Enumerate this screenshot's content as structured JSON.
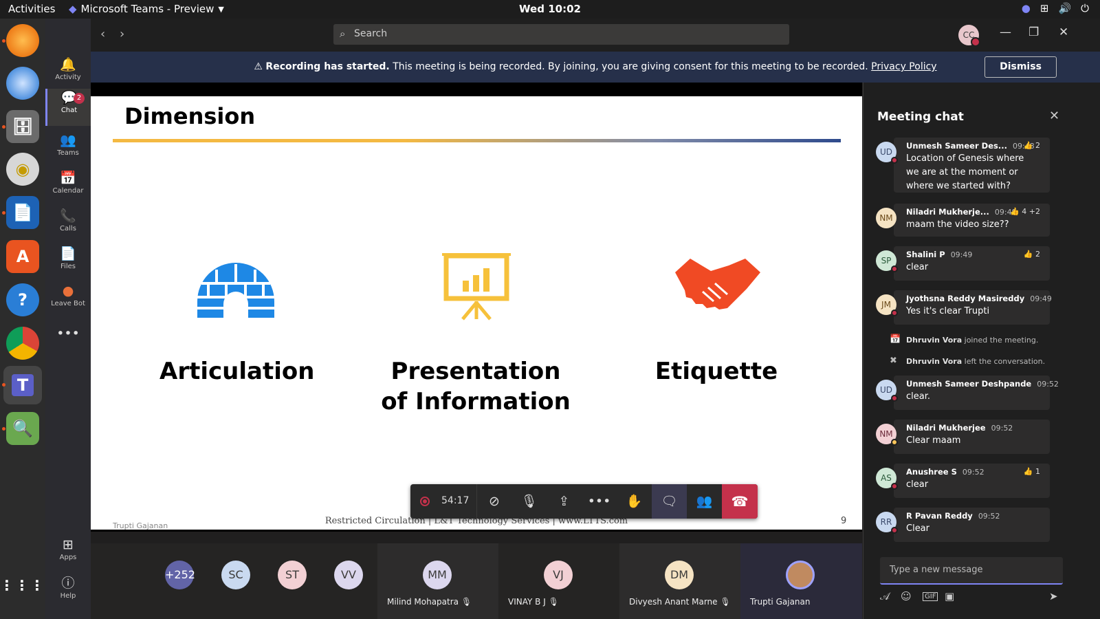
{
  "topbar": {
    "activities": "Activities",
    "app": "Microsoft Teams - Preview",
    "clock": "Wed 10:02"
  },
  "rail": {
    "items": [
      {
        "label": "Activity",
        "icon": "bell-icon",
        "glyph": "🔔"
      },
      {
        "label": "Chat",
        "icon": "chat-icon",
        "glyph": "💬",
        "badge": "2"
      },
      {
        "label": "Teams",
        "icon": "teams-icon",
        "glyph": "👥"
      },
      {
        "label": "Calendar",
        "icon": "calendar-icon",
        "glyph": "📅"
      },
      {
        "label": "Calls",
        "icon": "phone-icon",
        "glyph": "📞"
      },
      {
        "label": "Files",
        "icon": "file-icon",
        "glyph": "📄"
      },
      {
        "label": "Leave Bot",
        "icon": "leave-bot-icon",
        "glyph": "●"
      }
    ],
    "more": "•••",
    "apps": "Apps",
    "help": "Help"
  },
  "search": {
    "placeholder": "Search"
  },
  "profile": {
    "initials": "CC"
  },
  "banner": {
    "title": "Recording has started.",
    "text": "This meeting is being recorded. By joining, you are giving consent for this meeting to be recorded.",
    "link": "Privacy Policy",
    "dismiss": "Dismiss"
  },
  "slide": {
    "title": "Dimension",
    "items": [
      "Articulation",
      "Presentation of Information",
      "Etiquette"
    ],
    "footer": "Restricted Circulation | L&T Technology Services | www.LTTS.com",
    "presenter": "Trupti Gajanan",
    "page": "9"
  },
  "controls": {
    "timer": "54:17"
  },
  "gallery": {
    "overflow": "+252",
    "participants": [
      {
        "initials": "SC",
        "color": "#c9d9f0"
      },
      {
        "initials": "ST",
        "color": "#f2d0d4"
      },
      {
        "initials": "VV",
        "color": "#dcd7ee"
      },
      {
        "initials": "MM",
        "name": "Milind Mohapatra",
        "color": "#dcd7ee"
      },
      {
        "initials": "VJ",
        "name": "VINAY B J",
        "color": "#f2d0d4"
      },
      {
        "initials": "DM",
        "name": "Divyesh Anant Marne",
        "color": "#f5e3c3"
      },
      {
        "name": "Trupti Gajanan"
      }
    ]
  },
  "chat": {
    "title": "Meeting chat",
    "messages": [
      {
        "initials": "UD",
        "name": "Unmesh Sameer Des...",
        "time": "09:48",
        "reaction": "👍 2",
        "text": "Location of Genesis where we are at the moment or where we started with?",
        "avatar_color": "#c9d9f0"
      },
      {
        "initials": "NM",
        "name": "Niladri Mukherje...",
        "time": "09:49",
        "reaction": "👍 4  +2",
        "text": "maam the video size??",
        "avatar_color": "#f5e3c3"
      },
      {
        "initials": "SP",
        "name": "Shalini P",
        "time": "09:49",
        "reaction": "👍 2",
        "text": "clear",
        "avatar_color": "#cfe8d6"
      },
      {
        "initials": "JM",
        "name": "Jyothsna Reddy Masireddy",
        "time": "09:49",
        "reaction": "",
        "text": "Yes it's clear Trupti",
        "avatar_color": "#f5e3c3"
      },
      {
        "initials": "UD",
        "name": "Unmesh Sameer Deshpande",
        "time": "09:52",
        "reaction": "",
        "text": "clear.",
        "avatar_color": "#c9d9f0"
      },
      {
        "initials": "NM",
        "name": "Niladri Mukherjee",
        "time": "09:52",
        "reaction": "",
        "text": "Clear maam",
        "avatar_color": "#f2d0d4"
      },
      {
        "initials": "AS",
        "name": "Anushree S",
        "time": "09:52",
        "reaction": "👍 1",
        "text": "clear",
        "avatar_color": "#cfe8d6"
      },
      {
        "initials": "RR",
        "name": "R Pavan Reddy",
        "time": "09:52",
        "reaction": "",
        "text": "Clear",
        "avatar_color": "#c9d9f0"
      }
    ],
    "system": [
      {
        "name": "Dhruvin Vora",
        "action": "joined the meeting."
      },
      {
        "name": "Dhruvin Vora",
        "action": "left the conversation."
      }
    ],
    "compose_placeholder": "Type a new message"
  },
  "colors": {
    "accent": "#7f85f5",
    "record": "#c4314b",
    "banner": "#26304a"
  }
}
